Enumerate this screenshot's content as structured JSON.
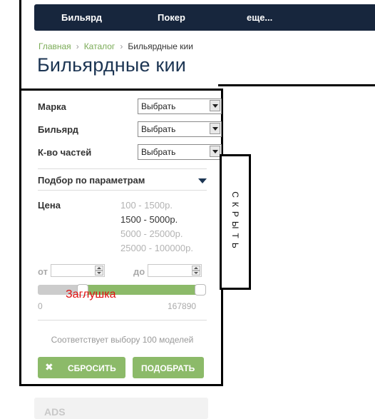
{
  "nav": {
    "items": [
      "Бильярд",
      "Покер",
      "еще..."
    ]
  },
  "breadcrumb": {
    "home": "Главная",
    "catalog": "Каталог",
    "current": "Бильярдные кии",
    "separator": "›"
  },
  "page_title": "Бильярдные кии",
  "filters": {
    "rows": [
      {
        "label": "Марка",
        "value": "Выбрать"
      },
      {
        "label": "Бильярд",
        "value": "Выбрать"
      },
      {
        "label": "К-во частей",
        "value": "Выбрать"
      }
    ],
    "params_heading": "Подбор по параметрам",
    "price_label": "Цена",
    "price_options": [
      {
        "label": "100 - 1500р.",
        "active": false
      },
      {
        "label": "1500 - 5000р.",
        "active": true
      },
      {
        "label": "5000 - 25000р.",
        "active": false
      },
      {
        "label": "25000 - 100000р.",
        "active": false
      }
    ],
    "from_label": "от",
    "to_label": "до",
    "from_value": "",
    "to_value": "",
    "slider": {
      "min": "0",
      "max": "167890",
      "low_fraction": 0.25,
      "high_fraction": 1.0,
      "stub_text": "Заглушка"
    },
    "match_text": "Соответствует выбору 100 моделей",
    "reset_label": "СБРОСИТЬ",
    "reset_icon": "✖",
    "apply_label": "ПОДОБРАТЬ"
  },
  "hide_tab": {
    "label": "СКРЫТЬ"
  },
  "ads": {
    "label": "ADS"
  },
  "colors": {
    "nav_bg": "#17263d",
    "accent_green": "#8cba69",
    "title_blue": "#1c3553",
    "stub_red": "#e01010"
  }
}
